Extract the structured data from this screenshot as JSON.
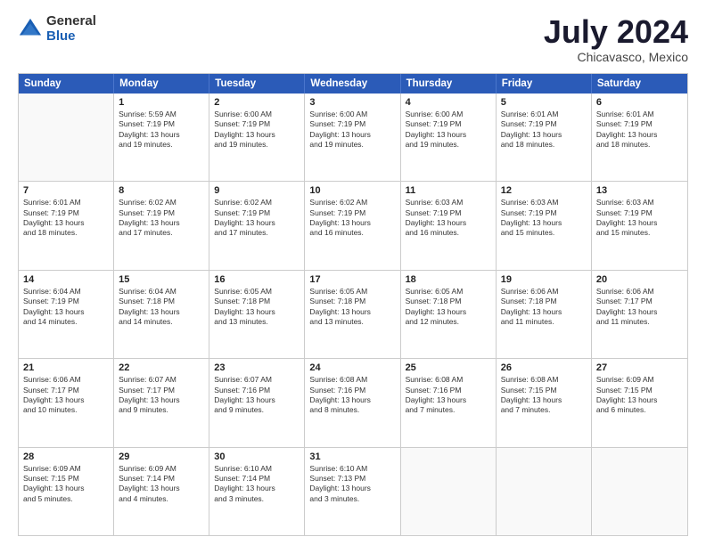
{
  "logo": {
    "general": "General",
    "blue": "Blue"
  },
  "title": "July 2024",
  "location": "Chicavasco, Mexico",
  "days": [
    "Sunday",
    "Monday",
    "Tuesday",
    "Wednesday",
    "Thursday",
    "Friday",
    "Saturday"
  ],
  "rows": [
    [
      {
        "day": "",
        "lines": []
      },
      {
        "day": "1",
        "lines": [
          "Sunrise: 5:59 AM",
          "Sunset: 7:19 PM",
          "Daylight: 13 hours",
          "and 19 minutes."
        ]
      },
      {
        "day": "2",
        "lines": [
          "Sunrise: 6:00 AM",
          "Sunset: 7:19 PM",
          "Daylight: 13 hours",
          "and 19 minutes."
        ]
      },
      {
        "day": "3",
        "lines": [
          "Sunrise: 6:00 AM",
          "Sunset: 7:19 PM",
          "Daylight: 13 hours",
          "and 19 minutes."
        ]
      },
      {
        "day": "4",
        "lines": [
          "Sunrise: 6:00 AM",
          "Sunset: 7:19 PM",
          "Daylight: 13 hours",
          "and 19 minutes."
        ]
      },
      {
        "day": "5",
        "lines": [
          "Sunrise: 6:01 AM",
          "Sunset: 7:19 PM",
          "Daylight: 13 hours",
          "and 18 minutes."
        ]
      },
      {
        "day": "6",
        "lines": [
          "Sunrise: 6:01 AM",
          "Sunset: 7:19 PM",
          "Daylight: 13 hours",
          "and 18 minutes."
        ]
      }
    ],
    [
      {
        "day": "7",
        "lines": [
          "Sunrise: 6:01 AM",
          "Sunset: 7:19 PM",
          "Daylight: 13 hours",
          "and 18 minutes."
        ]
      },
      {
        "day": "8",
        "lines": [
          "Sunrise: 6:02 AM",
          "Sunset: 7:19 PM",
          "Daylight: 13 hours",
          "and 17 minutes."
        ]
      },
      {
        "day": "9",
        "lines": [
          "Sunrise: 6:02 AM",
          "Sunset: 7:19 PM",
          "Daylight: 13 hours",
          "and 17 minutes."
        ]
      },
      {
        "day": "10",
        "lines": [
          "Sunrise: 6:02 AM",
          "Sunset: 7:19 PM",
          "Daylight: 13 hours",
          "and 16 minutes."
        ]
      },
      {
        "day": "11",
        "lines": [
          "Sunrise: 6:03 AM",
          "Sunset: 7:19 PM",
          "Daylight: 13 hours",
          "and 16 minutes."
        ]
      },
      {
        "day": "12",
        "lines": [
          "Sunrise: 6:03 AM",
          "Sunset: 7:19 PM",
          "Daylight: 13 hours",
          "and 15 minutes."
        ]
      },
      {
        "day": "13",
        "lines": [
          "Sunrise: 6:03 AM",
          "Sunset: 7:19 PM",
          "Daylight: 13 hours",
          "and 15 minutes."
        ]
      }
    ],
    [
      {
        "day": "14",
        "lines": [
          "Sunrise: 6:04 AM",
          "Sunset: 7:19 PM",
          "Daylight: 13 hours",
          "and 14 minutes."
        ]
      },
      {
        "day": "15",
        "lines": [
          "Sunrise: 6:04 AM",
          "Sunset: 7:18 PM",
          "Daylight: 13 hours",
          "and 14 minutes."
        ]
      },
      {
        "day": "16",
        "lines": [
          "Sunrise: 6:05 AM",
          "Sunset: 7:18 PM",
          "Daylight: 13 hours",
          "and 13 minutes."
        ]
      },
      {
        "day": "17",
        "lines": [
          "Sunrise: 6:05 AM",
          "Sunset: 7:18 PM",
          "Daylight: 13 hours",
          "and 13 minutes."
        ]
      },
      {
        "day": "18",
        "lines": [
          "Sunrise: 6:05 AM",
          "Sunset: 7:18 PM",
          "Daylight: 13 hours",
          "and 12 minutes."
        ]
      },
      {
        "day": "19",
        "lines": [
          "Sunrise: 6:06 AM",
          "Sunset: 7:18 PM",
          "Daylight: 13 hours",
          "and 11 minutes."
        ]
      },
      {
        "day": "20",
        "lines": [
          "Sunrise: 6:06 AM",
          "Sunset: 7:17 PM",
          "Daylight: 13 hours",
          "and 11 minutes."
        ]
      }
    ],
    [
      {
        "day": "21",
        "lines": [
          "Sunrise: 6:06 AM",
          "Sunset: 7:17 PM",
          "Daylight: 13 hours",
          "and 10 minutes."
        ]
      },
      {
        "day": "22",
        "lines": [
          "Sunrise: 6:07 AM",
          "Sunset: 7:17 PM",
          "Daylight: 13 hours",
          "and 9 minutes."
        ]
      },
      {
        "day": "23",
        "lines": [
          "Sunrise: 6:07 AM",
          "Sunset: 7:16 PM",
          "Daylight: 13 hours",
          "and 9 minutes."
        ]
      },
      {
        "day": "24",
        "lines": [
          "Sunrise: 6:08 AM",
          "Sunset: 7:16 PM",
          "Daylight: 13 hours",
          "and 8 minutes."
        ]
      },
      {
        "day": "25",
        "lines": [
          "Sunrise: 6:08 AM",
          "Sunset: 7:16 PM",
          "Daylight: 13 hours",
          "and 7 minutes."
        ]
      },
      {
        "day": "26",
        "lines": [
          "Sunrise: 6:08 AM",
          "Sunset: 7:15 PM",
          "Daylight: 13 hours",
          "and 7 minutes."
        ]
      },
      {
        "day": "27",
        "lines": [
          "Sunrise: 6:09 AM",
          "Sunset: 7:15 PM",
          "Daylight: 13 hours",
          "and 6 minutes."
        ]
      }
    ],
    [
      {
        "day": "28",
        "lines": [
          "Sunrise: 6:09 AM",
          "Sunset: 7:15 PM",
          "Daylight: 13 hours",
          "and 5 minutes."
        ]
      },
      {
        "day": "29",
        "lines": [
          "Sunrise: 6:09 AM",
          "Sunset: 7:14 PM",
          "Daylight: 13 hours",
          "and 4 minutes."
        ]
      },
      {
        "day": "30",
        "lines": [
          "Sunrise: 6:10 AM",
          "Sunset: 7:14 PM",
          "Daylight: 13 hours",
          "and 3 minutes."
        ]
      },
      {
        "day": "31",
        "lines": [
          "Sunrise: 6:10 AM",
          "Sunset: 7:13 PM",
          "Daylight: 13 hours",
          "and 3 minutes."
        ]
      },
      {
        "day": "",
        "lines": []
      },
      {
        "day": "",
        "lines": []
      },
      {
        "day": "",
        "lines": []
      }
    ]
  ]
}
